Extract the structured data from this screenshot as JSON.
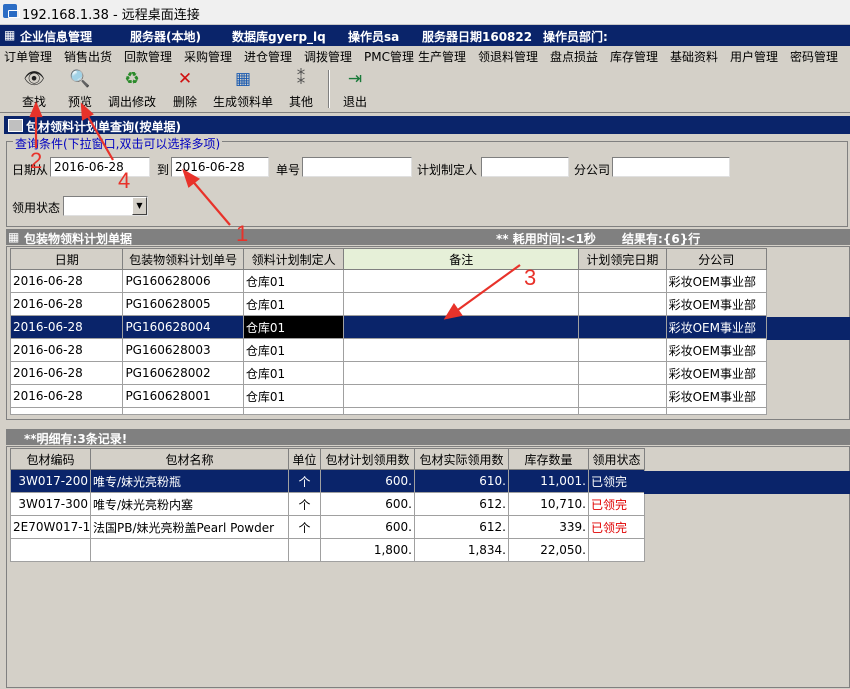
{
  "rdp": {
    "title": "192.168.1.38 - 远程桌面连接"
  },
  "app": {
    "name": "企业信息管理",
    "server": "服务器(本地)",
    "database": "数据库gyerp_lq",
    "operator": "操作员sa",
    "server_date": "服务器日期160822",
    "operator_dept": "操作员部门:"
  },
  "menu": [
    "订单管理",
    "销售出货",
    "回款管理",
    "采购管理",
    "进仓管理",
    "调拨管理",
    "PMC管理",
    "生产管理",
    "领退料管理",
    "盘点损益",
    "库存管理",
    "基础资料",
    "用户管理",
    "密码管理"
  ],
  "toolbar": {
    "find": "查找",
    "preview": "预览",
    "import_edit": "调出修改",
    "delete": "删除",
    "generate": "生成领料单",
    "other": "其他",
    "exit": "退出"
  },
  "window": {
    "title": "包材领料计划单查询(按单据)"
  },
  "query": {
    "legend": "查询条件(下拉窗口,双击可以选择多项)",
    "date_label": "日期从",
    "date_from": "2016-06-28",
    "to_label": "到",
    "date_to": "2016-06-28",
    "order_label": "单号",
    "order_value": "",
    "planner_label": "计划制定人",
    "planner_value": "",
    "branch_label": "分公司",
    "branch_value": "",
    "status_label": "领用状态",
    "status_value": ""
  },
  "plan_section": {
    "title": "包装物领料计划单据",
    "timing": "** 耗用时间:<1秒",
    "result": "结果有:{6}行"
  },
  "plan_table": {
    "headers": [
      "日期",
      "包装物领料计划单号",
      "领料计划制定人",
      "备注",
      "计划领完日期",
      "分公司"
    ],
    "rows": [
      [
        "2016-06-28",
        "PG160628006",
        "仓库01",
        "",
        "",
        "彩妆OEM事业部"
      ],
      [
        "2016-06-28",
        "PG160628005",
        "仓库01",
        "",
        "",
        "彩妆OEM事业部"
      ],
      [
        "2016-06-28",
        "PG160628004",
        "仓库01",
        "",
        "",
        "彩妆OEM事业部"
      ],
      [
        "2016-06-28",
        "PG160628003",
        "仓库01",
        "",
        "",
        "彩妆OEM事业部"
      ],
      [
        "2016-06-28",
        "PG160628002",
        "仓库01",
        "",
        "",
        "彩妆OEM事业部"
      ],
      [
        "2016-06-28",
        "PG160628001",
        "仓库01",
        "",
        "",
        "彩妆OEM事业部"
      ]
    ],
    "selected_row": 2
  },
  "detail_section": {
    "title": "**明细有:3条记录!"
  },
  "detail_table": {
    "headers": [
      "包材编码",
      "包材名称",
      "单位",
      "包材计划领用数",
      "包材实际领用数",
      "库存数量",
      "领用状态"
    ],
    "rows": [
      [
        "3W017-200",
        "唯专/妹光亮粉瓶",
        "个",
        "600.",
        "610.",
        "11,001.",
        "已领完"
      ],
      [
        "3W017-300",
        "唯专/妹光亮粉内塞",
        "个",
        "600.",
        "612.",
        "10,710.",
        "已领完"
      ],
      [
        "2E70W017-100",
        "法国PB/妹光亮粉盖Pearl Powder",
        "个",
        "600.",
        "612.",
        "339.",
        "已领完"
      ]
    ],
    "totals": [
      "",
      "",
      "",
      "1,800.",
      "1,834.",
      "22,050.",
      ""
    ],
    "selected_row": 0
  },
  "annotations": [
    "1",
    "2",
    "3",
    "4"
  ],
  "colors": {
    "title_bar": "#0a246a",
    "selection": "#0a246a",
    "annotation": "#e8322a",
    "status_done": "#e00000"
  }
}
